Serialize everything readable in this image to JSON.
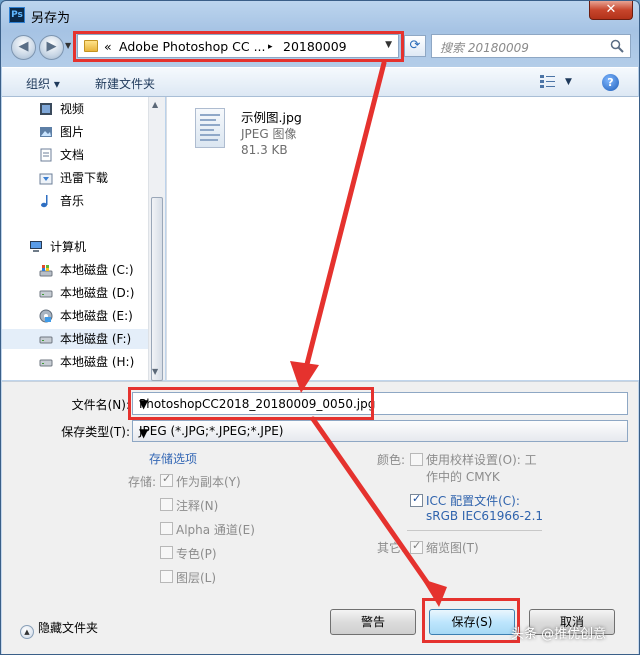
{
  "window": {
    "title": "另存为",
    "app_badge": "Ps",
    "close_label": "✕"
  },
  "address": {
    "prefix": "«",
    "segment1": "Adobe Photoshop CC ...",
    "separator": "▸",
    "segment2": "20180009"
  },
  "search": {
    "placeholder": "搜索 20180009"
  },
  "toolbar": {
    "organize": "组织 ▾",
    "new_folder": "新建文件夹",
    "help": "?"
  },
  "nav": {
    "items": [
      {
        "label": "视频",
        "icon": "video-icon"
      },
      {
        "label": "图片",
        "icon": "pictures-icon"
      },
      {
        "label": "文档",
        "icon": "documents-icon"
      },
      {
        "label": "迅雷下载",
        "icon": "download-folder-icon"
      },
      {
        "label": "音乐",
        "icon": "music-icon"
      },
      {
        "label": "计算机",
        "icon": "computer-icon"
      },
      {
        "label": "本地磁盘 (C:)",
        "icon": "system-drive-icon"
      },
      {
        "label": "本地磁盘 (D:)",
        "icon": "drive-icon"
      },
      {
        "label": "本地磁盘 (E:)",
        "icon": "drive-icon"
      },
      {
        "label": "本地磁盘 (F:)",
        "icon": "drive-icon",
        "selected": true
      },
      {
        "label": "本地磁盘 (H:)",
        "icon": "drive-icon"
      }
    ]
  },
  "files": [
    {
      "name": "示例图.jpg",
      "type": "JPEG 图像",
      "size": "81.3 KB"
    }
  ],
  "form": {
    "filename_label": "文件名(N):",
    "filename_value": "PhotoshopCC2018_20180009_0050.jpg",
    "filetype_label": "保存类型(T):",
    "filetype_value": "JPEG (*.JPG;*.JPEG;*.JPE)"
  },
  "options": {
    "title": "存储选项",
    "storage_label": "存储:",
    "as_copy": "作为副本(Y)",
    "notes": "注释(N)",
    "alpha": "Alpha 通道(E)",
    "spot": "专色(P)",
    "layers": "图层(L)",
    "color_label": "颜色:",
    "proof_line1": "使用校样设置(O):  工",
    "proof_line2": "作中的 CMYK",
    "icc_line1": "ICC 配置文件(C):",
    "icc_line2": "sRGB IEC61966-2.1",
    "other_label": "其它:",
    "thumbnail": "缩览图(T)"
  },
  "footer": {
    "hide_folders": "隐藏文件夹",
    "warning_button": "警告",
    "save_button": "保存(S)",
    "cancel_button": "取消"
  },
  "watermark": "头条 @推优创意",
  "colors": {
    "highlight": "#e5322e",
    "link_blue": "#3568b5"
  }
}
